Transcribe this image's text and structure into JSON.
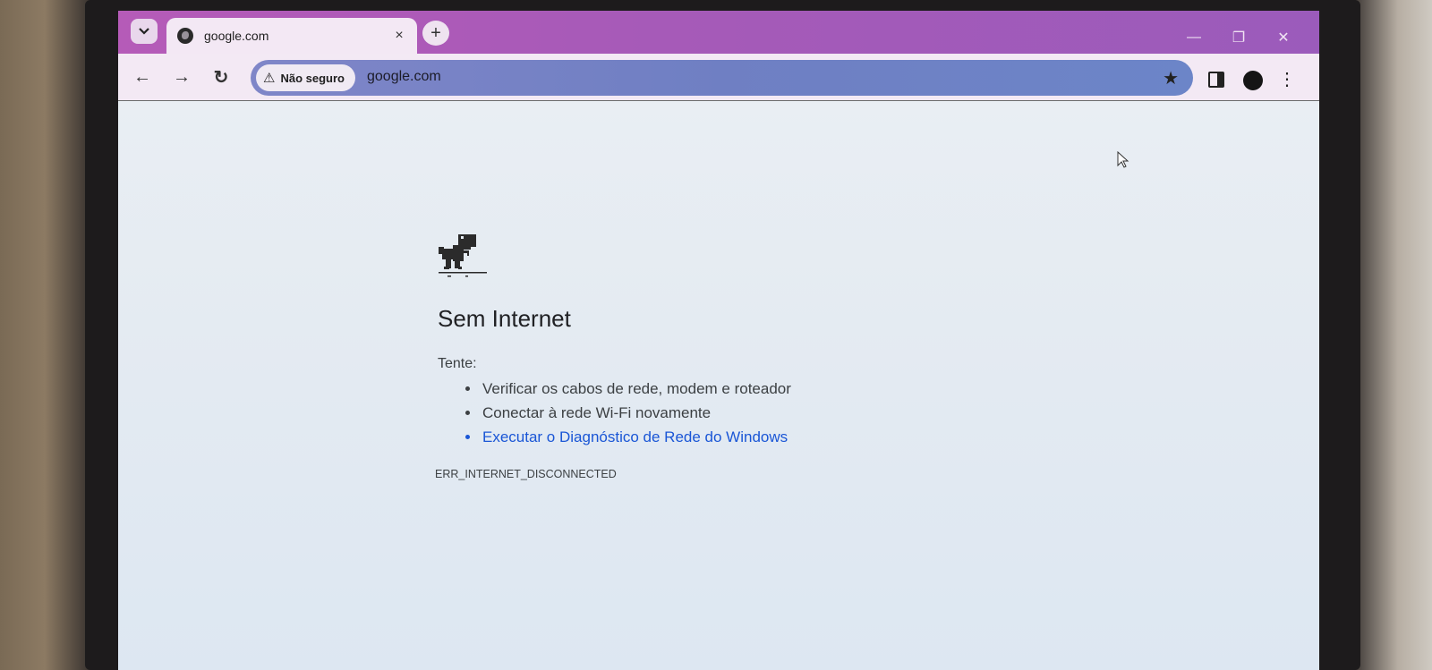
{
  "browser": {
    "tab_title": "google.com",
    "tab_close": "×",
    "new_tab": "+",
    "window_controls": {
      "minimize": "—",
      "maximize": "❐",
      "close": "✕"
    }
  },
  "toolbar": {
    "back_icon": "←",
    "forward_icon": "→",
    "reload_icon": "↻",
    "security_chip": "Não seguro",
    "url": "google.com",
    "bookmark_icon": "★",
    "menu_icon": "⋮"
  },
  "page": {
    "heading": "Sem Internet",
    "try_label": "Tente:",
    "suggestions": [
      "Verificar os cabos de rede, modem e roteador",
      "Conectar à rede Wi-Fi novamente",
      "Executar o Diagnóstico de Rede do Windows"
    ],
    "error_code": "ERR_INTERNET_DISCONNECTED"
  },
  "colors": {
    "titlebar": "#a65ab8",
    "toolbar": "#f3e9f4",
    "omnibox": "#6f7fc3",
    "link": "#1a56d6"
  }
}
